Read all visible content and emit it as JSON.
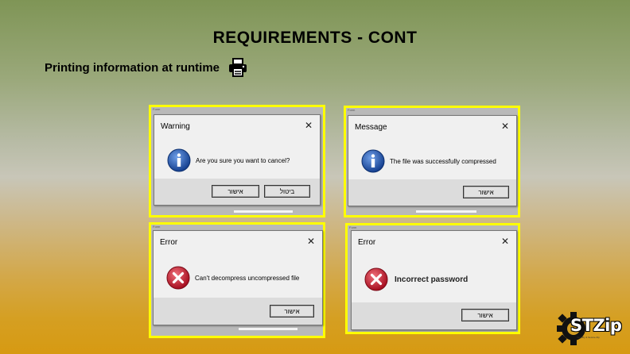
{
  "slide": {
    "title": "REQUIREMENTS - CONT",
    "subtitle": "Printing information at runtime",
    "subtitle_icon": "printer-icon"
  },
  "dialogs": [
    {
      "title": "Warning",
      "icon": "info-icon",
      "message": "Are you sure you want to cancel?",
      "buttons": [
        "אישור",
        "ביטול"
      ],
      "close": "✕"
    },
    {
      "title": "Message",
      "icon": "info-icon",
      "message": "The file was successfully compressed",
      "buttons": [
        "אישור"
      ],
      "close": "✕"
    },
    {
      "title": "Error",
      "icon": "error-icon",
      "message": "Can't decompress uncompressed file",
      "buttons": [
        "אישור"
      ],
      "close": "✕"
    },
    {
      "title": "Error",
      "icon": "error-icon",
      "message": "Incorrect password",
      "buttons": [
        "אישור"
      ],
      "close": "✕"
    }
  ],
  "logo": {
    "text": "STZip",
    "tagline": "Simplify & Secure Zip"
  },
  "colors": {
    "frame_highlight": "#ffff00",
    "info_blue": "#1f4fa8",
    "error_red": "#c8102e"
  }
}
